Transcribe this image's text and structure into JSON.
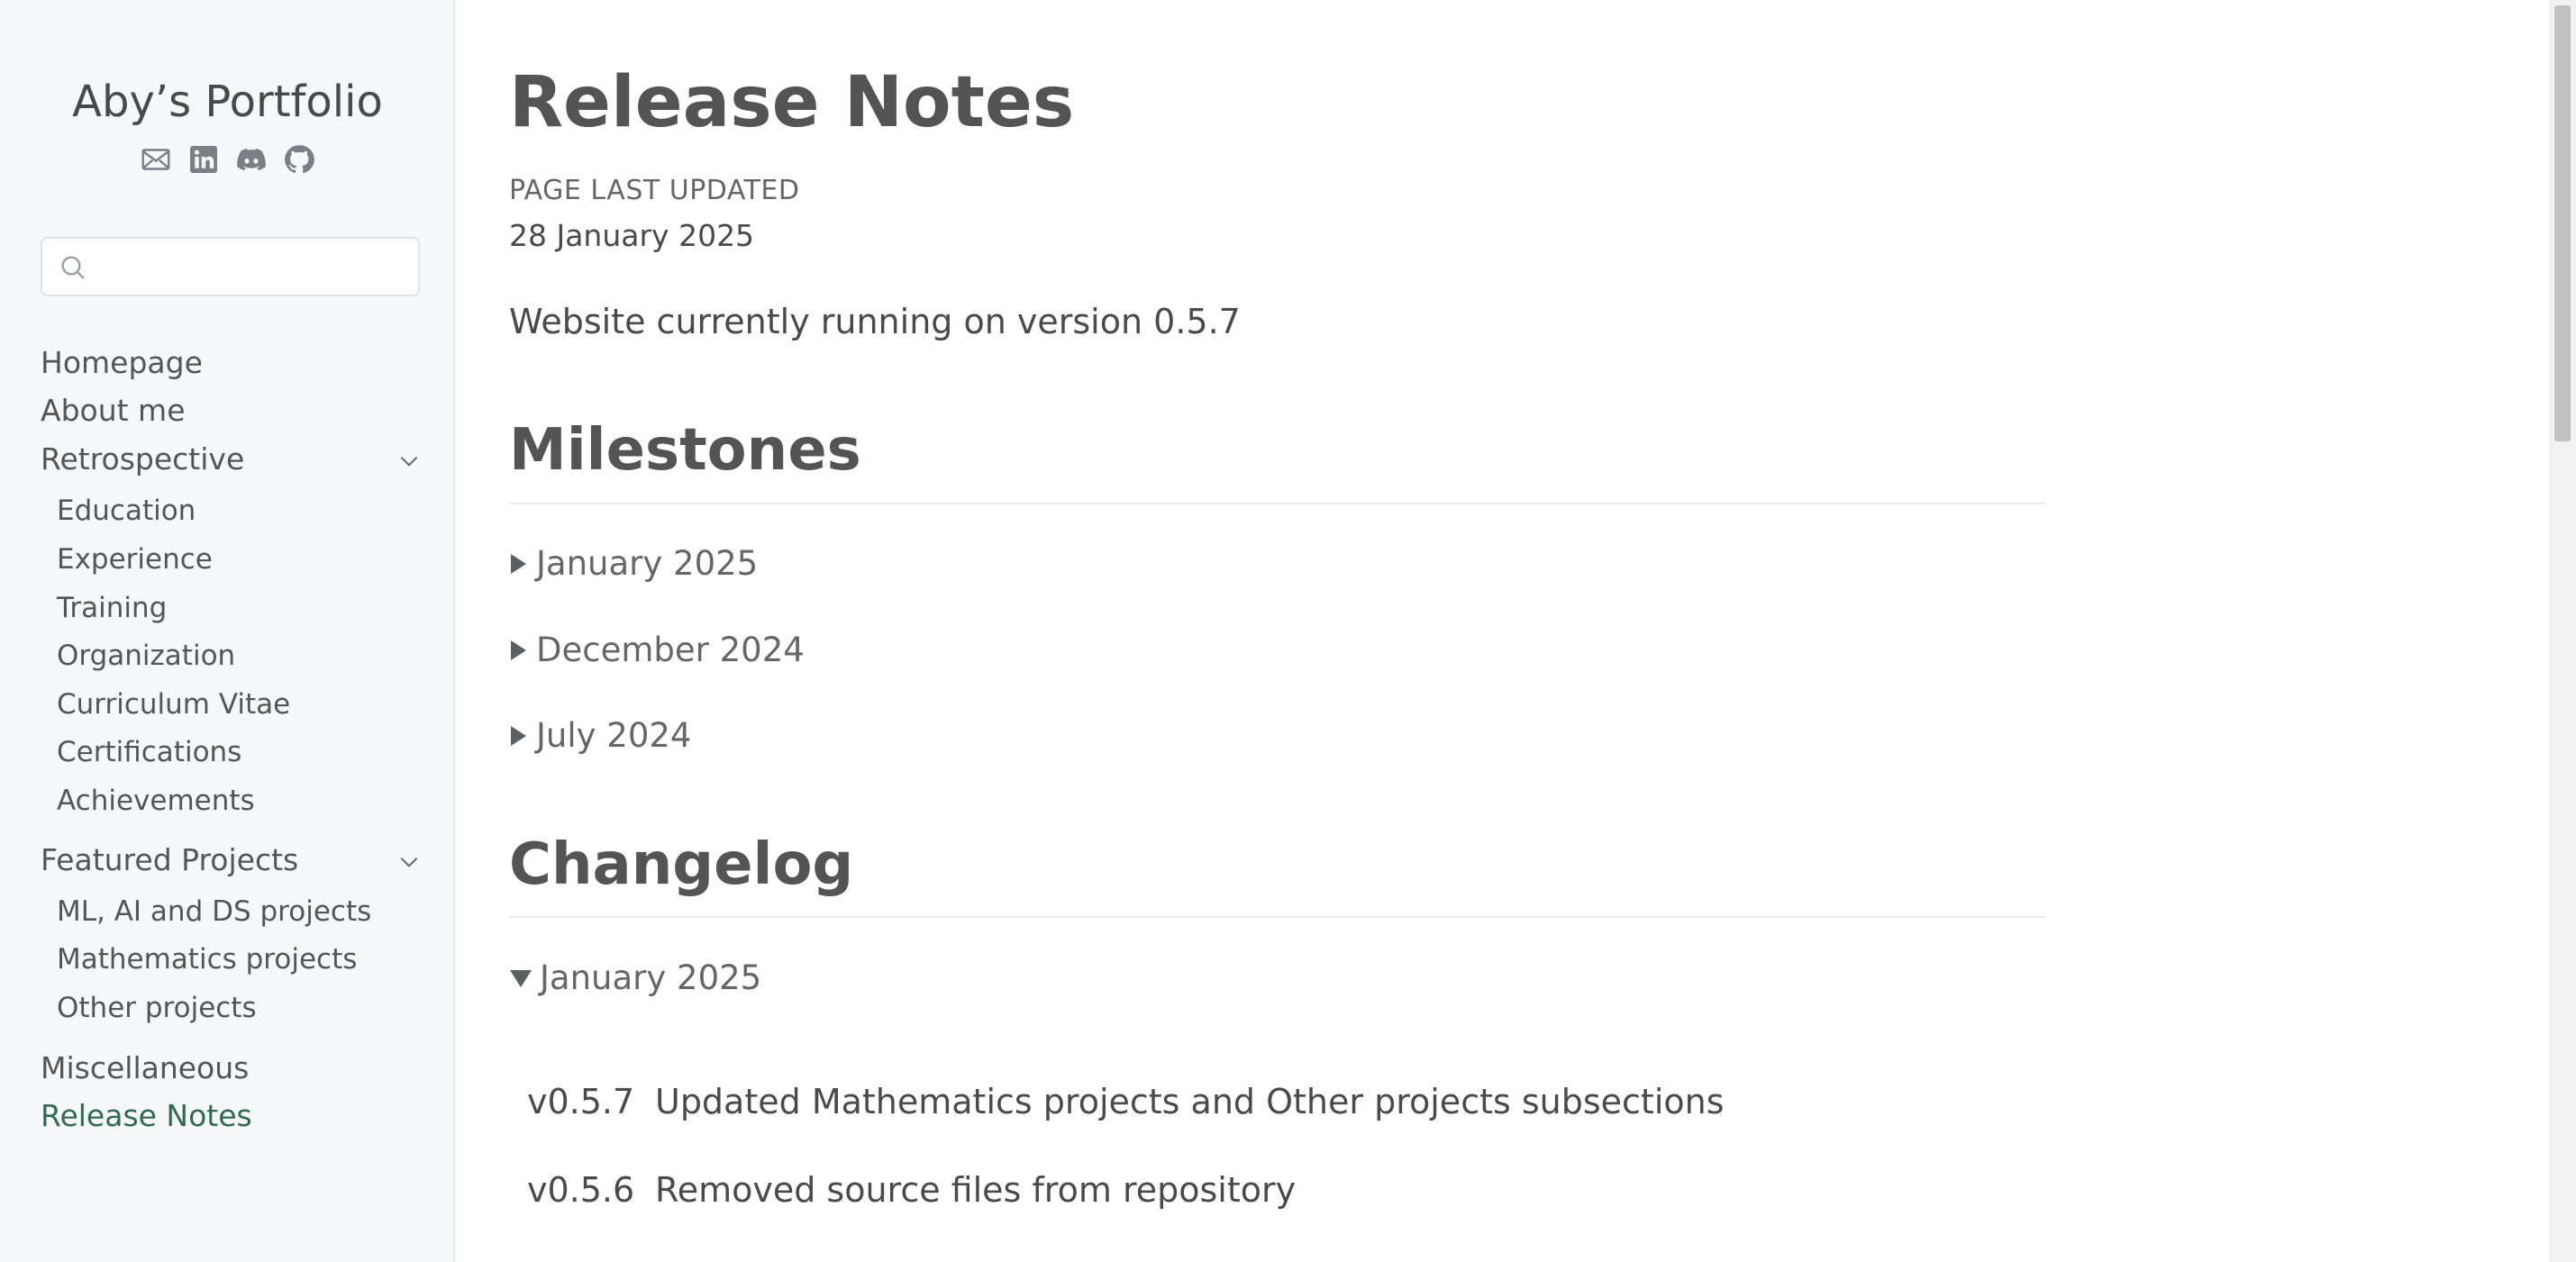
{
  "sidebar": {
    "site_title": "Aby’s Portfolio",
    "social_icons": [
      "mail-icon",
      "linkedin-icon",
      "discord-icon",
      "github-icon"
    ],
    "search": {
      "placeholder": "",
      "value": ""
    },
    "nav": {
      "homepage": "Homepage",
      "about": "About me",
      "retrospective": {
        "label": "Retrospective",
        "children": [
          "Education",
          "Experience",
          "Training",
          "Organization",
          "Curriculum Vitae",
          "Certifications",
          "Achievements"
        ]
      },
      "featured": {
        "label": "Featured Projects",
        "children": [
          "ML, AI and DS projects",
          "Mathematics projects",
          "Other projects"
        ]
      },
      "misc": "Miscellaneous",
      "release_notes": "Release Notes"
    },
    "active_item": "Release Notes",
    "active_color": "#2f6b50"
  },
  "main": {
    "title": "Release Notes",
    "updated_label": "PAGE LAST UPDATED",
    "updated_date": "28 January 2025",
    "version_text": "Website currently running on version 0.5.7",
    "milestones": {
      "heading": "Milestones",
      "items": [
        "January 2025",
        "December 2024",
        "July 2024"
      ]
    },
    "changelog": {
      "heading": "Changelog",
      "open_section": "January 2025",
      "entries": [
        {
          "version": "v0.5.7",
          "text": "Updated Mathematics projects and Other projects subsections"
        },
        {
          "version": "v0.5.6",
          "text": "Removed source files from repository"
        }
      ]
    }
  }
}
